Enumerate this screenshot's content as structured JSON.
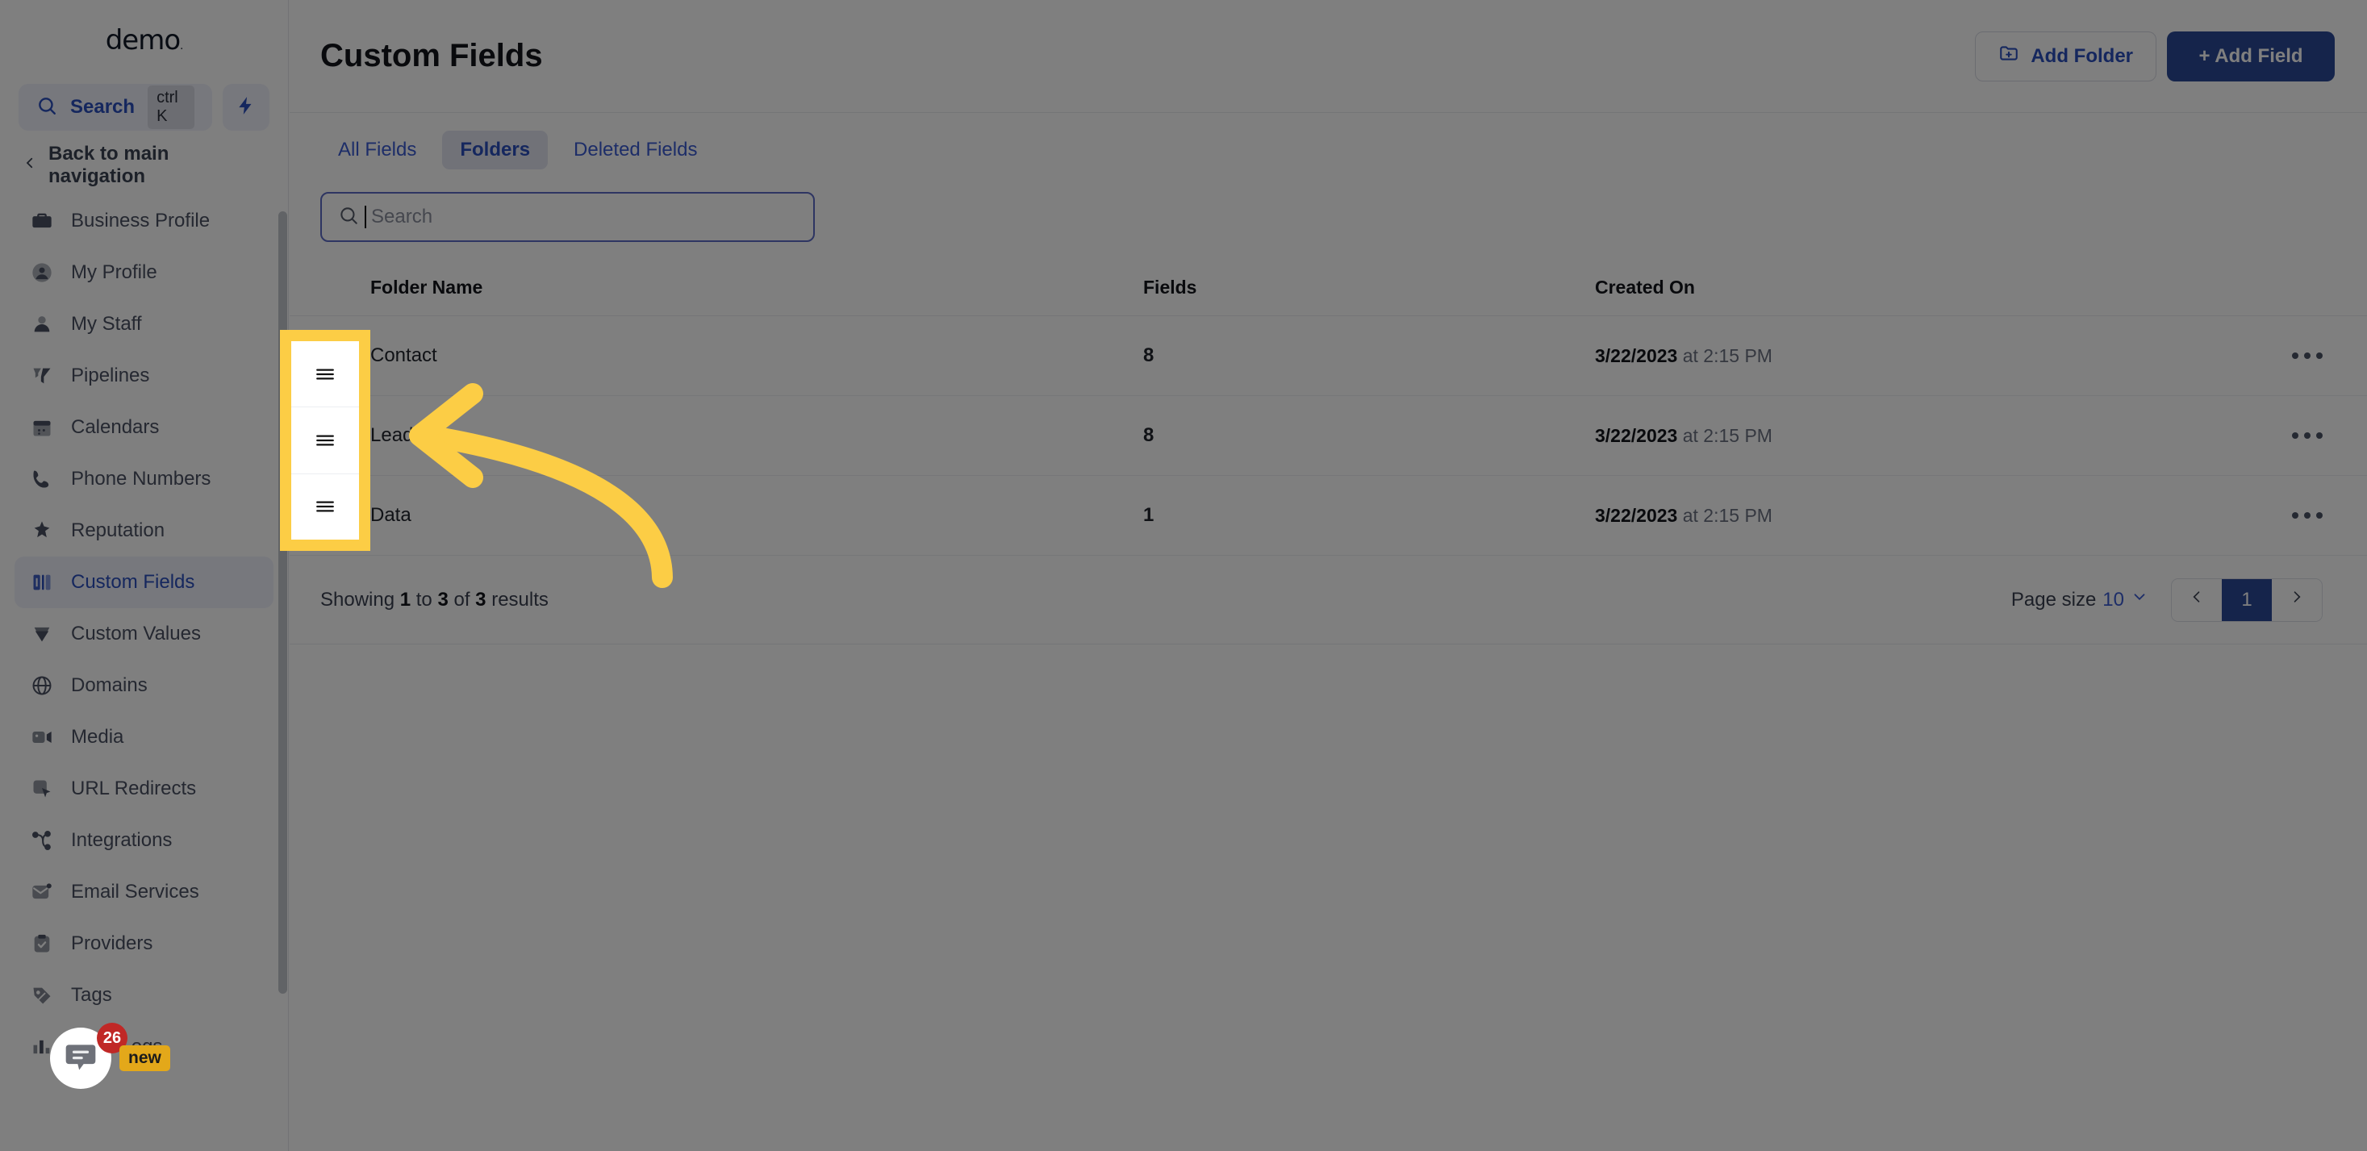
{
  "sidebar": {
    "brand": "demo",
    "brand_mark": ".",
    "search": {
      "label": "Search",
      "shortcut": "ctrl K",
      "icon": "search-icon"
    },
    "quick_action_icon": "lightning-bolt-icon",
    "back_label": "Back to main navigation",
    "items": [
      {
        "label": "Business Profile",
        "icon": "briefcase-icon",
        "active": false
      },
      {
        "label": "My Profile",
        "icon": "user-circle-icon",
        "active": false
      },
      {
        "label": "My Staff",
        "icon": "person-icon",
        "active": false
      },
      {
        "label": "Pipelines",
        "icon": "funnel-icon",
        "active": false
      },
      {
        "label": "Calendars",
        "icon": "calendar-icon",
        "active": false
      },
      {
        "label": "Phone Numbers",
        "icon": "phone-icon",
        "active": false
      },
      {
        "label": "Reputation",
        "icon": "star-sparkle-icon",
        "active": false
      },
      {
        "label": "Custom Fields",
        "icon": "custom-fields-icon",
        "active": true
      },
      {
        "label": "Custom Values",
        "icon": "gem-icon",
        "active": false
      },
      {
        "label": "Domains",
        "icon": "globe-icon",
        "active": false
      },
      {
        "label": "Media",
        "icon": "video-camera-icon",
        "active": false
      },
      {
        "label": "URL Redirects",
        "icon": "cursor-square-icon",
        "active": false
      },
      {
        "label": "Integrations",
        "icon": "share-nodes-icon",
        "active": false
      },
      {
        "label": "Email Services",
        "icon": "envelope-icon",
        "active": false
      },
      {
        "label": "Providers",
        "icon": "clipboard-check-icon",
        "active": false
      },
      {
        "label": "Tags",
        "icon": "tag-icon",
        "active": false
      },
      {
        "label": "Audit Logs",
        "icon": "bar-chart-icon",
        "active": false
      }
    ],
    "chat": {
      "icon": "chat-bubble-icon",
      "badge": "26",
      "new_label": "new"
    }
  },
  "header": {
    "title": "Custom Fields",
    "add_folder_label": "Add Folder",
    "add_folder_icon": "folder-plus-icon",
    "add_field_label": "+ Add Field"
  },
  "tabs": [
    {
      "label": "All Fields",
      "active": false
    },
    {
      "label": "Folders",
      "active": true
    },
    {
      "label": "Deleted Fields",
      "active": false
    }
  ],
  "search": {
    "placeholder": "Search",
    "value": "",
    "icon": "search-icon"
  },
  "table": {
    "columns": [
      "Folder Name",
      "Fields",
      "Created On"
    ],
    "rows": [
      {
        "drag_icon": "drag-handle-icon",
        "name": "Contact",
        "fields": "8",
        "created_date": "3/22/2023",
        "created_time": "at 2:15 PM",
        "menu_icon": "ellipsis-icon"
      },
      {
        "drag_icon": "drag-handle-icon",
        "name": "Lead gen",
        "fields": "8",
        "created_date": "3/22/2023",
        "created_time": "at 2:15 PM",
        "menu_icon": "ellipsis-icon"
      },
      {
        "drag_icon": "drag-handle-icon",
        "name": "Data",
        "fields": "1",
        "created_date": "3/22/2023",
        "created_time": "at 2:15 PM",
        "menu_icon": "ellipsis-icon"
      }
    ]
  },
  "footer": {
    "showing_prefix": "Showing",
    "showing_from": "1",
    "showing_mid": "to",
    "showing_to": "3",
    "showing_of": "of",
    "showing_total": "3",
    "showing_suffix": "results",
    "page_size_label": "Page size",
    "page_size_value": "10",
    "prev_icon": "chevron-left-icon",
    "next_icon": "chevron-right-icon",
    "current_page": "1"
  },
  "annotation": {
    "highlight_color": "#fccd45",
    "arrow_color": "#fccd45",
    "arrow_icon": "curved-arrow-left-icon",
    "highlight_target": "drag-handle-column"
  },
  "colors": {
    "accent": "#2b4896",
    "link": "#3a5bd0",
    "scrim": "rgba(0,0,0,0.5)"
  }
}
